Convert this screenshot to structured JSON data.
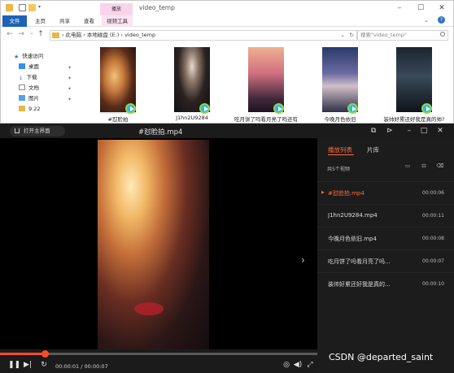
{
  "explorer": {
    "ctx_tab_label": "播放",
    "window_title": "video_temp",
    "ribbon_tabs": [
      "文件",
      "主页",
      "共享",
      "查看",
      "视频工具"
    ],
    "address_path": "› 此电脑 › 本地磁盘 (E:) › video_temp",
    "search_placeholder": "搜索\"video_temp\"",
    "sidebar": [
      "快速访问",
      "桌面",
      "下载",
      "文档",
      "图片",
      "9.22"
    ],
    "files": [
      "#怼脸拍",
      "J1hn2U9284",
      "吃月饼了吗看月亮了吗还有",
      "今晚月色依旧",
      "装帅好累还好我是真的帅?"
    ]
  },
  "player": {
    "open_home_label": "打开主界面",
    "title": "#怼脸拍.mp4",
    "playlist_tab": "播放列表",
    "library_tab": "片库",
    "count_text": "共5个视频",
    "items": [
      {
        "name": "#怼脸拍.mp4",
        "duration": "00:00:06",
        "current": true
      },
      {
        "name": "J1hn2U9284.mp4",
        "duration": "00:00:11",
        "current": false
      },
      {
        "name": "今晚月色依旧.mp4",
        "duration": "00:00:08",
        "current": false
      },
      {
        "name": "吃月饼了吗看月亮了吗...",
        "duration": "00:00:07",
        "current": false
      },
      {
        "name": "装帅好累还好我是真的...",
        "duration": "00:00:10",
        "current": false
      }
    ],
    "time_text": "00:00:01 / 00:00:07",
    "progress": 0.14,
    "accent": "#ff6a3a"
  },
  "watermark": "CSDN @departed_saint"
}
